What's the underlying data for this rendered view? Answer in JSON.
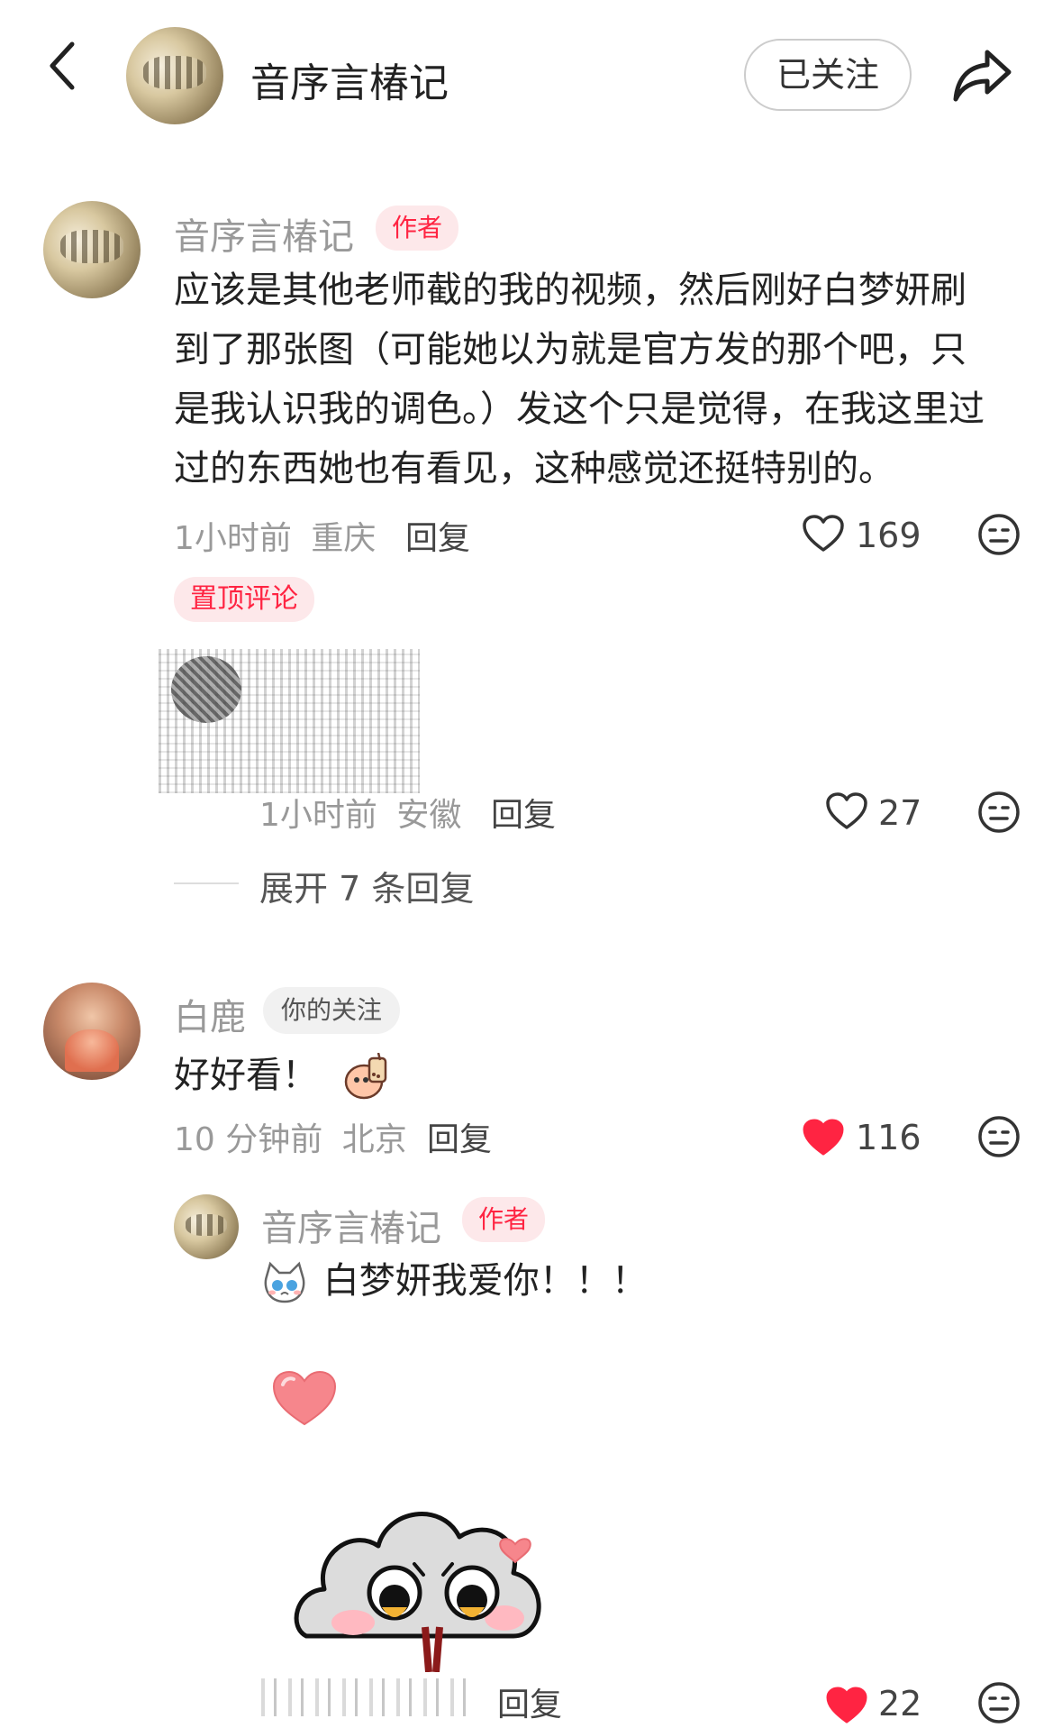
{
  "header": {
    "title": "音序言椿记",
    "follow_label": "已关注"
  },
  "comments": [
    {
      "author": "音序言椿记",
      "author_tag": "作者",
      "text_lines": [
        "应该是其他老师截的我的视频，然后刚好白梦妍刷",
        "到了那张图（可能她以为就是官方发的那个吧，只",
        "是我认识我的调色。）发这个只是觉得，在我这里过",
        "过的东西她也有看见，这种感觉还挺特别的。"
      ],
      "time": "1小时前",
      "location": "重庆",
      "reply_label": "回复",
      "likes": "169",
      "liked": false,
      "pinned_label": "置顶评论",
      "sub_reply": {
        "time": "1小时前",
        "location": "安徽",
        "reply_label": "回复",
        "likes": "27",
        "liked": false
      },
      "expand_label": "展开 7 条回复"
    },
    {
      "author": "白鹿",
      "author_tag": "你的关注",
      "text": "好好看！",
      "time": "10 分钟前",
      "location": "北京",
      "reply_label": "回复",
      "likes": "116",
      "liked": true,
      "reply": {
        "author": "音序言椿记",
        "author_tag": "作者",
        "text": "白梦妍我爱你！！！",
        "reply_label": "回复",
        "likes": "22",
        "liked": true
      }
    }
  ],
  "colors": {
    "accent": "#ff2442",
    "meta_text": "#999999",
    "body_text": "#222222"
  }
}
